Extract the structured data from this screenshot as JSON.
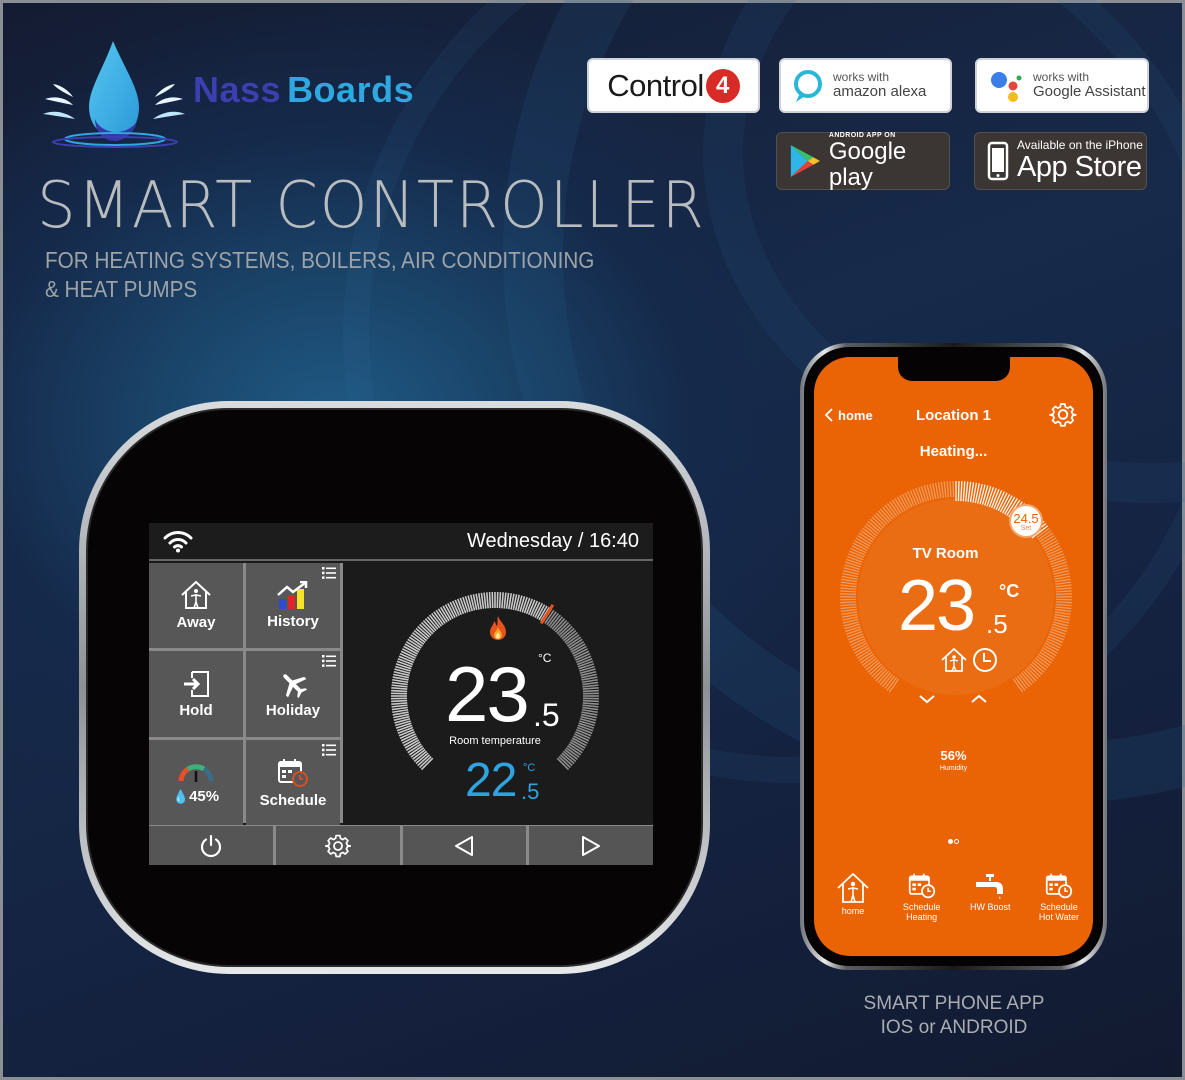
{
  "brand": {
    "name_part1": "Nass",
    "name_part2": "Boards",
    "logo_icon": "water-drop-splash-icon",
    "color_primary": "#3b3fb0",
    "color_secondary": "#2fa7e0"
  },
  "badges": {
    "control4": {
      "text": "Control",
      "mark": "4"
    },
    "alexa": {
      "line1": "works with",
      "line2": "amazon alexa"
    },
    "google_assistant": {
      "line1": "works with",
      "line2": "Google Assistant"
    },
    "google_play": {
      "line1": "ANDROID APP ON",
      "line2": "Google play"
    },
    "app_store": {
      "line1": "Available on the iPhone",
      "line2": "App Store"
    }
  },
  "headline": "SMART CONTROLLER",
  "subheadline": {
    "line1": "FOR HEATING SYSTEMS, BOILERS, AIR CONDITIONING",
    "line2": "&  HEAT PUMPS"
  },
  "thermostat": {
    "datetime": "Wednesday / 16:40",
    "wifi_icon": "wifi-icon",
    "tiles": [
      {
        "label": "Away",
        "icon": "away-house-person-icon",
        "has_menu": false
      },
      {
        "label": "History",
        "icon": "history-chart-icon",
        "has_menu": true
      },
      {
        "label": "Hold",
        "icon": "hold-enter-door-icon",
        "has_menu": false
      },
      {
        "label": "Holiday",
        "icon": "airplane-icon",
        "has_menu": true
      },
      {
        "label": "45%",
        "icon": "humidity-gauge-icon",
        "has_menu": false
      },
      {
        "label": "Schedule",
        "icon": "schedule-calendar-clock-icon",
        "has_menu": true
      }
    ],
    "room_temp_int": "23",
    "room_temp_dec": ".5",
    "unit": "°C",
    "room_label": "Room temperature",
    "set_temp_int": "22",
    "set_temp_dec": ".5",
    "heating_icon": "flame-icon",
    "bottom_buttons": [
      {
        "name": "power",
        "icon": "power-icon"
      },
      {
        "name": "settings",
        "icon": "gear-icon"
      },
      {
        "name": "previous",
        "icon": "triangle-left-icon"
      },
      {
        "name": "next",
        "icon": "triangle-right-icon"
      }
    ],
    "accent_blue": "#2fa2e0"
  },
  "phone_app": {
    "back_label": "home",
    "title": "Location 1",
    "status": "Heating...",
    "room_name": "TV Room",
    "temp_int": "23",
    "temp_dec": ".5",
    "unit": "°C",
    "set_value": "24.5",
    "set_label": "Set",
    "humidity_value": "56%",
    "humidity_label": "Humidity",
    "page_count": 2,
    "active_page": 1,
    "nav": [
      {
        "label_line1": "home",
        "label_line2": "",
        "icon": "home-person-icon"
      },
      {
        "label_line1": "Schedule",
        "label_line2": "Heating",
        "icon": "schedule-calendar-clock-icon"
      },
      {
        "label_line1": "HW Boost",
        "label_line2": "",
        "icon": "water-tap-icon"
      },
      {
        "label_line1": "Schedule",
        "label_line2": "Hot Water",
        "icon": "schedule-calendar-clock-icon"
      }
    ],
    "accent_color": "#ea6405"
  },
  "caption": {
    "line1": "SMART PHONE APP",
    "line2": "IOS or ANDROID"
  }
}
